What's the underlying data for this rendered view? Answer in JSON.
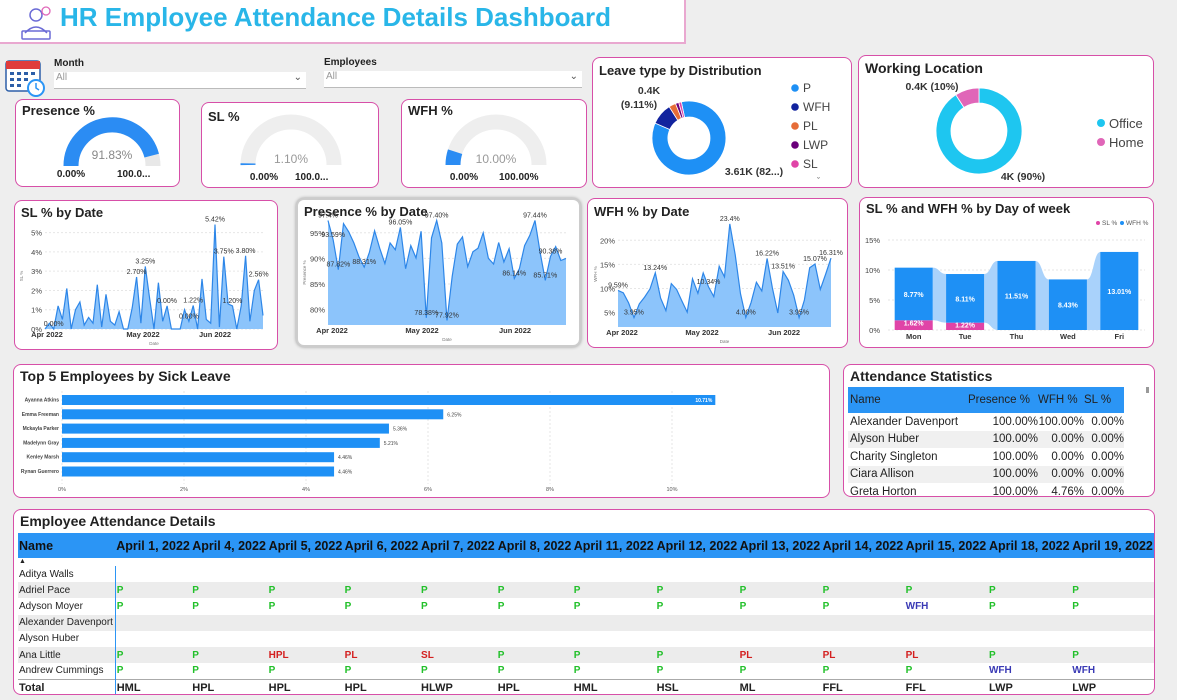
{
  "header": {
    "title": "HR Employee Attendance Details Dashboard"
  },
  "filters": {
    "month": {
      "label": "Month",
      "value": "All"
    },
    "employees": {
      "label": "Employees",
      "value": "All"
    }
  },
  "gauges": [
    {
      "title": "Presence %",
      "value": 91.83,
      "value_label": "91.83%",
      "min_label": "0.00%",
      "max_label": "100.0..."
    },
    {
      "title": "SL %",
      "value": 1.1,
      "value_label": "1.10%",
      "min_label": "0.00%",
      "max_label": "100.0..."
    },
    {
      "title": "WFH %",
      "value": 10.0,
      "value_label": "10.00%",
      "min_label": "0.00%",
      "max_label": "100.00%"
    }
  ],
  "leave_type": {
    "title": "Leave type by Distribution",
    "callout_small_value": "0.4K",
    "callout_small_pct": "(9.11%)",
    "callout_large": "3.61K (82...)",
    "legend": [
      {
        "label": "P",
        "color": "#1e90f5"
      },
      {
        "label": "WFH",
        "color": "#12239e"
      },
      {
        "label": "PL",
        "color": "#e66c37"
      },
      {
        "label": "LWP",
        "color": "#6b007b"
      },
      {
        "label": "SL",
        "color": "#e044a7"
      }
    ]
  },
  "working_location": {
    "title": "Working Location",
    "home_label": "0.4K (10%)",
    "office_label": "4K (90%)",
    "legend": [
      {
        "label": "Office",
        "color": "#1ec6f0"
      },
      {
        "label": "Home",
        "color": "#e066b8"
      }
    ]
  },
  "line_charts": {
    "sl": {
      "title": "SL % by Date",
      "ylabel": "SL %",
      "xlabel": "Date"
    },
    "presence": {
      "title": "Presence % by Date",
      "ylabel": "Presence %",
      "xlabel": "Date"
    },
    "wfh": {
      "title": "WFH % by Date",
      "ylabel": "WFH %",
      "xlabel": "Date"
    }
  },
  "weekday": {
    "title": "SL % and WFH % by Day of week"
  },
  "top5": {
    "title": "Top 5 Employees by Sick Leave"
  },
  "stats": {
    "title": "Attendance Statistics",
    "columns": [
      "Name",
      "Presence %",
      "WFH %",
      "SL %"
    ],
    "rows": [
      [
        "Alexander Davenport",
        "100.00%",
        "100.00%",
        "0.00%"
      ],
      [
        "Alyson Huber",
        "100.00%",
        "0.00%",
        "0.00%"
      ],
      [
        "Charity Singleton",
        "100.00%",
        "0.00%",
        "0.00%"
      ],
      [
        "Ciara Allison",
        "100.00%",
        "0.00%",
        "0.00%"
      ],
      [
        "Greta Horton",
        "100.00%",
        "4.76%",
        "0.00%"
      ]
    ]
  },
  "details": {
    "title": "Employee Attendance Details",
    "columns": [
      "Name",
      "April 1, 2022",
      "April 4, 2022",
      "April 5, 2022",
      "April 6, 2022",
      "April 7, 2022",
      "April 8, 2022",
      "April 11, 2022",
      "April 12, 2022",
      "April 13, 2022",
      "April 14, 2022",
      "April 15, 2022",
      "April 18, 2022",
      "April 19, 2022"
    ],
    "rows": [
      [
        "Aditya Walls",
        "",
        "",
        "",
        "",
        "",
        "",
        "",
        "",
        "",
        "",
        "",
        "",
        ""
      ],
      [
        "Adriel Pace",
        "P",
        "P",
        "P",
        "P",
        "P",
        "P",
        "P",
        "P",
        "P",
        "P",
        "P",
        "P",
        "P"
      ],
      [
        "Adyson Moyer",
        "P",
        "P",
        "P",
        "P",
        "P",
        "P",
        "P",
        "P",
        "P",
        "P",
        "WFH",
        "P",
        "P"
      ],
      [
        "Alexander Davenport",
        "",
        "",
        "",
        "",
        "",
        "",
        "",
        "",
        "",
        "",
        "",
        "",
        ""
      ],
      [
        "Alyson Huber",
        "",
        "",
        "",
        "",
        "",
        "",
        "",
        "",
        "",
        "",
        "",
        "",
        ""
      ],
      [
        "Ana Little",
        "P",
        "P",
        "HPL",
        "PL",
        "SL",
        "P",
        "P",
        "P",
        "PL",
        "PL",
        "PL",
        "P",
        "P"
      ],
      [
        "Andrew Cummings",
        "P",
        "P",
        "P",
        "P",
        "P",
        "P",
        "P",
        "P",
        "P",
        "P",
        "P",
        "WFH",
        "WFH"
      ]
    ],
    "total": [
      "Total",
      "HML",
      "HPL",
      "HPL",
      "HPL",
      "HLWP",
      "HPL",
      "HML",
      "HSL",
      "ML",
      "FFL",
      "FFL",
      "LWP",
      "LWP"
    ]
  },
  "chart_data": [
    {
      "type": "pie",
      "title": "Leave type by Distribution",
      "categories": [
        "P",
        "WFH",
        "PL",
        "LWP",
        "SL"
      ],
      "values": [
        3610,
        400,
        130,
        60,
        50
      ]
    },
    {
      "type": "pie",
      "title": "Working Location",
      "categories": [
        "Office",
        "Home"
      ],
      "values": [
        4000,
        400
      ]
    },
    {
      "type": "area",
      "title": "SL % by Date",
      "xlabel": "Date",
      "ylabel": "SL %",
      "x_ticks": [
        "Apr 2022",
        "May 2022",
        "Jun 2022"
      ],
      "y_ticks": [
        "0%",
        "1%",
        "2%",
        "3%",
        "4%",
        "5%"
      ],
      "ylim": [
        0,
        5.5
      ],
      "values": [
        0,
        0.3,
        0,
        1.2,
        0.5,
        2.1,
        0,
        1.0,
        1.4,
        0.2,
        0.6,
        0.3,
        2.3,
        0.1,
        1.8,
        0.4,
        0.2,
        0.9,
        0,
        0,
        1.1,
        2.7,
        0.3,
        3.25,
        1.6,
        0,
        2.4,
        0.4,
        1.2,
        0,
        0,
        0,
        1.0,
        0.4,
        1.22,
        0,
        2.6,
        0.5,
        0.3,
        5.42,
        0.1,
        3.75,
        1.3,
        1.2,
        0,
        1.2,
        3.8,
        0.4,
        2.0,
        2.56,
        0.7
      ]
    },
    {
      "type": "area",
      "title": "Presence % by Date",
      "xlabel": "Date",
      "ylabel": "Presence %",
      "x_ticks": [
        "Apr 2022",
        "May 2022",
        "Jun 2022"
      ],
      "y_ticks": [
        "80%",
        "85%",
        "90%",
        "95%"
      ],
      "ylim": [
        77,
        97.5
      ],
      "values": [
        97.4,
        93.6,
        87.8,
        96.8,
        95.2,
        93.0,
        90.3,
        88.3,
        91.2,
        95.4,
        92.0,
        89.0,
        93.0,
        91.7,
        96.05,
        88.0,
        92.5,
        90.1,
        95.3,
        78.4,
        94.0,
        97.4,
        93.0,
        77.9,
        86.5,
        92.8,
        94.2,
        88.4,
        91.3,
        92.0,
        95.0,
        90.0,
        88.9,
        93.1,
        89.3,
        91.9,
        86.1,
        88.0,
        92.5,
        94.5,
        97.4,
        91.2,
        85.7,
        90.4,
        92.3,
        89.6,
        90.0
      ]
    },
    {
      "type": "area",
      "title": "WFH % by Date",
      "xlabel": "Date",
      "ylabel": "WFH %",
      "x_ticks": [
        "Apr 2022",
        "May 2022",
        "Jun 2022"
      ],
      "y_ticks": [
        "5%",
        "10%",
        "15%",
        "20%"
      ],
      "ylim": [
        2,
        24
      ],
      "values": [
        9.6,
        9.1,
        7.0,
        3.95,
        6.8,
        8.2,
        9.9,
        13.24,
        8.0,
        5.4,
        11.0,
        9.8,
        7.4,
        5.1,
        12.0,
        9.0,
        13.2,
        10.34,
        8.3,
        14.6,
        12.4,
        23.4,
        17.0,
        8.9,
        4.0,
        7.1,
        11.3,
        9.5,
        16.22,
        10.1,
        4.9,
        13.51,
        11.7,
        8.6,
        3.95,
        7.6,
        14.3,
        15.07,
        9.8,
        13.0,
        16.31
      ]
    },
    {
      "type": "bar",
      "title": "SL % and WFH % by Day of week",
      "categories": [
        "Mon",
        "Tue",
        "Thu",
        "Wed",
        "Fri"
      ],
      "series": [
        {
          "name": "SL %",
          "values": [
            1.62,
            1.22,
            0,
            0,
            0
          ]
        },
        {
          "name": "WFH %",
          "values": [
            8.77,
            8.11,
            11.51,
            8.43,
            13.01
          ]
        }
      ],
      "value_labels": {
        "SL %": [
          "1.62%",
          "1.22%",
          "",
          "",
          ""
        ],
        "WFH %": [
          "8.77%",
          "8.11%",
          "11.51%",
          "8.43%",
          "13.01%"
        ]
      },
      "y_ticks": [
        "0%",
        "5%",
        "10%",
        "15%"
      ],
      "ylim": [
        0,
        15
      ]
    },
    {
      "type": "bar",
      "title": "Top 5 Employees by Sick Leave",
      "categories": [
        "Ayanna Atkins",
        "Emma Freeman",
        "Mckayla Parker",
        "Madelynn Gray",
        "Kenley Marsh",
        "Rynan Guerrero"
      ],
      "values": [
        10.71,
        6.25,
        5.36,
        5.21,
        4.46,
        4.46
      ],
      "value_labels": [
        "10.71%",
        "6.25%",
        "5.36%",
        "5.21%",
        "4.46%",
        "4.46%"
      ],
      "x_ticks": [
        "0%",
        "2%",
        "4%",
        "6%",
        "8%",
        "10%"
      ],
      "xlim": [
        0,
        12
      ]
    }
  ]
}
